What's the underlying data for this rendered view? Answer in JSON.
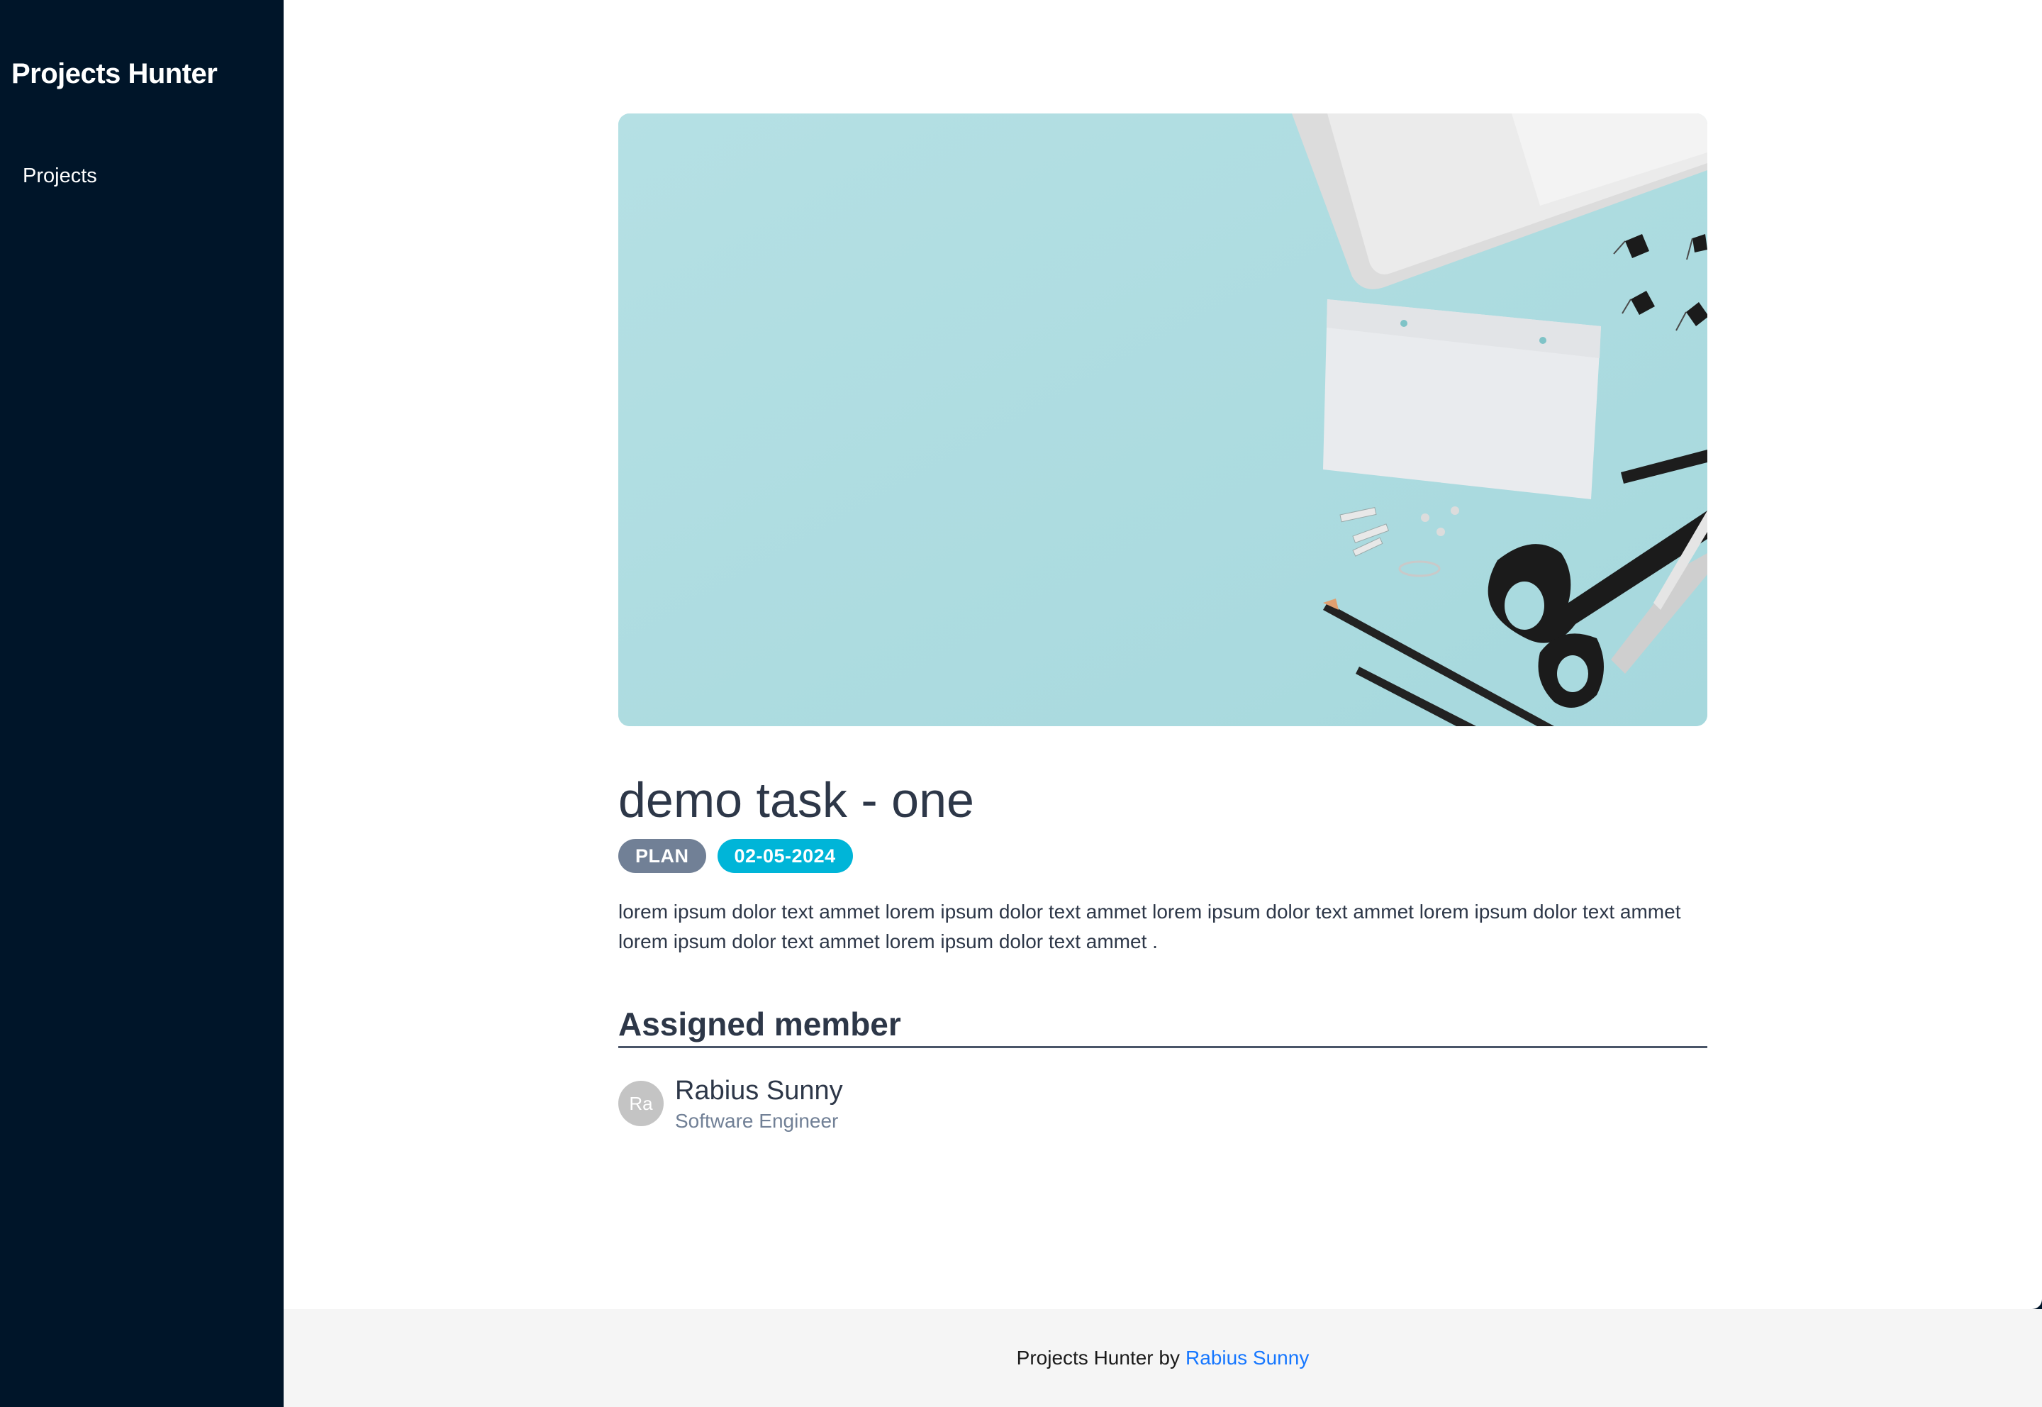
{
  "sidebar": {
    "brand": "Projects Hunter",
    "items": [
      {
        "label": "Projects"
      }
    ]
  },
  "task": {
    "title": "demo task - one",
    "status": "PLAN",
    "date": "02-05-2024",
    "description": "lorem ipsum dolor text ammet lorem ipsum dolor text ammet lorem ipsum dolor text ammet lorem ipsum dolor text ammet lorem ipsum dolor text ammet lorem ipsum dolor text ammet ."
  },
  "assigned": {
    "heading": "Assigned member",
    "members": [
      {
        "initials": "Ra",
        "name": "Rabius Sunny",
        "role": "Software Engineer"
      }
    ]
  },
  "footer": {
    "text": "Projects Hunter by",
    "link_label": "Rabius Sunny"
  },
  "colors": {
    "sidebar_bg": "#001529",
    "status_tag": "#718096",
    "date_tag": "#00b5d8",
    "link": "#1677ff",
    "cover_bg": "#b2dfe2"
  }
}
